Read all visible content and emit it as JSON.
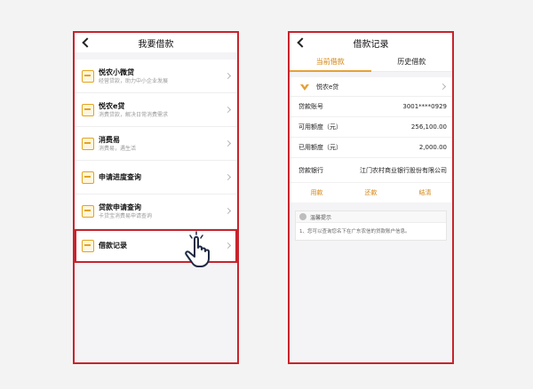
{
  "left": {
    "title": "我要借款",
    "items": [
      {
        "title": "悦农小微贷",
        "sub": "经营贷款，助力中小企业发展"
      },
      {
        "title": "悦农e贷",
        "sub": "消费贷款，解决日常消费需求"
      },
      {
        "title": "消费易",
        "sub": "消费易，遇生活"
      },
      {
        "title": "申请进度查询",
        "sub": ""
      },
      {
        "title": "贷款申请查询",
        "sub": "卡贷宝消费易申请查询"
      },
      {
        "title": "借款记录",
        "sub": ""
      }
    ]
  },
  "right": {
    "title": "借款记录",
    "tabs": [
      "当前借款",
      "历史借款"
    ],
    "loan_name": "悦农e贷",
    "rows": [
      {
        "label": "贷款账号",
        "value": "3001****0929"
      },
      {
        "label": "可用额度（元）",
        "value": "256,100.00"
      },
      {
        "label": "已用额度（元）",
        "value": "2,000.00"
      },
      {
        "label": "贷款银行",
        "value": "江门农村商业银行股份有限公司"
      }
    ],
    "actions": [
      "用款",
      "还款",
      "结清"
    ],
    "tip_title": "温馨提示",
    "tip_text": "1、您可以查询您名下在广东农信的贷款账户信息。"
  }
}
